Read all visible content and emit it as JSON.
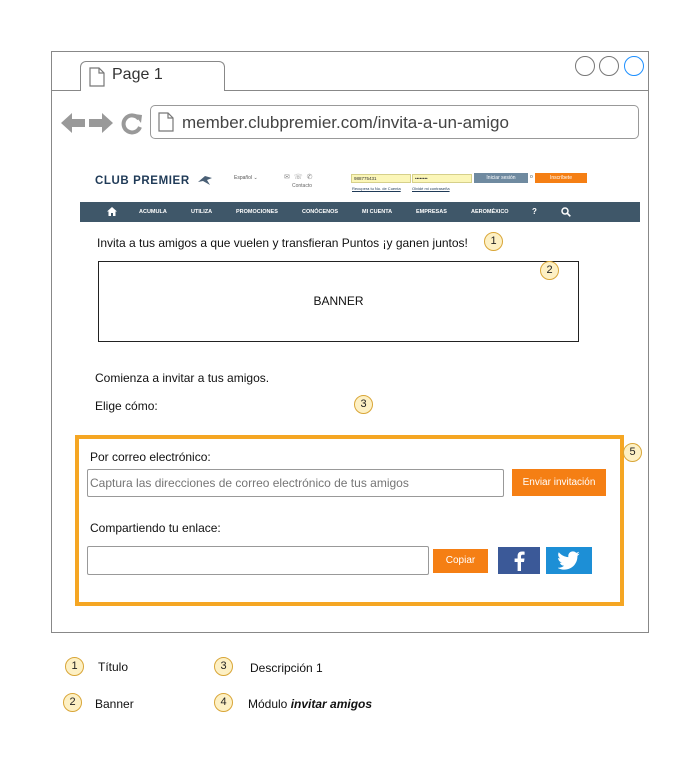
{
  "browser": {
    "tab_title": "Page 1",
    "url": "member.clubpremier.com/invita-a-un-amigo"
  },
  "site_header": {
    "logo_text": "CLUB PREMIER",
    "language": "Español",
    "contact_label": "Contacto",
    "login_user_value": "988775431",
    "login_pass_value": "••••••••",
    "login_button": "Iniciar sesión",
    "or_label": "o",
    "signup_button": "Inscríbete",
    "forgot_account": "Recupera tu No. de Cuenta",
    "forgot_password": "Olvidé mi contraseña"
  },
  "main_nav": {
    "home_icon": "home-icon",
    "items": [
      "ACUMULA",
      "UTILIZA",
      "PROMOCIONES",
      "CONÓCENOS",
      "MI CUENTA",
      "EMPRESAS",
      "AEROMÉXICO"
    ],
    "help": "?",
    "search_icon": "search-icon"
  },
  "content": {
    "title": "Invita a tus amigos a que vuelen y transfieran Puntos ¡y ganen juntos!",
    "banner": "BANNER",
    "desc_line1": "Comienza a invitar a tus amigos.",
    "desc_line2": "Elige cómo:"
  },
  "invite_module": {
    "email_label": "Por correo electrónico:",
    "email_placeholder": "Captura las direcciones de correo electrónico de tus amigos",
    "send_button": "Enviar invitación",
    "share_label": "Compartiendo tu enlace:",
    "copy_button": "Copiar",
    "facebook_icon": "facebook-icon",
    "twitter_icon": "twitter-icon"
  },
  "badges": [
    "1",
    "2",
    "3",
    "5"
  ],
  "legend": [
    {
      "num": "1",
      "label": "Título"
    },
    {
      "num": "3",
      "label": "Descripción 1"
    },
    {
      "num": "2",
      "label": "Banner"
    },
    {
      "num": "4",
      "label": "Módulo ",
      "label_em": "invitar amigos"
    }
  ],
  "colors": {
    "accent_orange": "#f57f14",
    "module_border": "#f5a623",
    "nav_bg": "#3f5769",
    "facebook": "#3b5998",
    "twitter": "#1d8fd6"
  }
}
